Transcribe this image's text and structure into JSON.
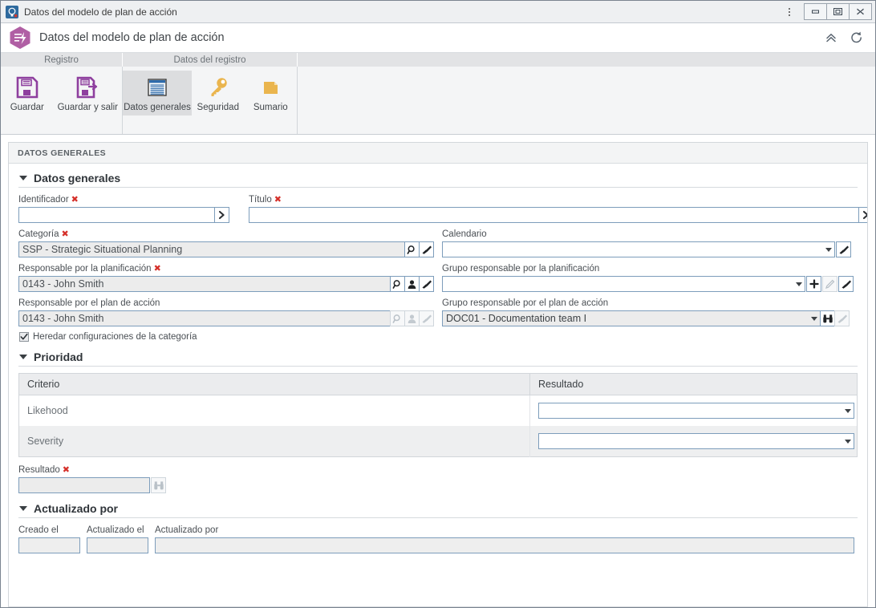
{
  "window": {
    "title": "Datos del modelo de plan de acción",
    "app_icon": "softexpert-hexagon-icon",
    "menu_icon": "vertical-dots-icon",
    "minimize_label": "Minimizar",
    "maximize_label": "Maximizar",
    "close_label": "Cerrar"
  },
  "header": {
    "title": "Datos del modelo de plan de acción",
    "collapse_icon": "double-chevron-up-icon",
    "refresh_icon": "refresh-icon"
  },
  "ribbon": {
    "tabs": [
      {
        "label": "Registro"
      },
      {
        "label": "Datos del registro"
      },
      {
        "label": ""
      }
    ],
    "groups": [
      {
        "buttons": [
          {
            "label": "Guardar",
            "icon": "save-floppy-icon",
            "active": false
          },
          {
            "label": "Guardar y salir",
            "icon": "save-and-exit-floppy-icon",
            "active": false
          }
        ]
      },
      {
        "buttons": [
          {
            "label": "Datos generales",
            "icon": "general-data-window-icon",
            "active": true
          },
          {
            "label": "Seguridad",
            "icon": "key-icon",
            "active": false
          },
          {
            "label": "Sumario",
            "icon": "document-page-icon",
            "active": false
          }
        ]
      }
    ]
  },
  "panel": {
    "header": "DATOS GENERALES"
  },
  "sections": {
    "general": {
      "title": "Datos generales",
      "collapse_icon": "triangle-down-icon",
      "fields": {
        "identificador": {
          "label": "Identificador",
          "required": true,
          "value": "",
          "button_icon": "chevron-right-icon"
        },
        "titulo": {
          "label": "Título",
          "required": true,
          "value": "",
          "button_icon": "chevron-right-icon"
        },
        "categoria": {
          "label": "Categoría",
          "required": true,
          "value": "SSP - Strategic Situational Planning",
          "readonly": true,
          "buttons": [
            "search-magnifier-icon",
            "clear-brush-icon"
          ]
        },
        "calendario": {
          "label": "Calendario",
          "required": false,
          "value": "",
          "buttons": [
            "clear-brush-icon"
          ]
        },
        "responsable_planificacion": {
          "label": "Responsable por la planificación",
          "required": true,
          "value": "0143 - John Smith",
          "readonly": true,
          "buttons": [
            "search-magnifier-icon",
            "person-icon",
            "clear-brush-icon"
          ]
        },
        "grupo_responsable_planificacion": {
          "label": "Grupo responsable por la planificación",
          "required": false,
          "value": "",
          "buttons": [
            "plus-icon",
            "pencil-icon-disabled",
            "clear-brush-icon"
          ]
        },
        "responsable_plan_accion": {
          "label": "Responsable por el plan de acción",
          "required": false,
          "value": "0143 - John Smith",
          "readonly": true,
          "buttons": [
            "search-magnifier-icon-disabled",
            "person-icon-disabled",
            "clear-brush-icon-disabled"
          ]
        },
        "grupo_responsable_plan_accion": {
          "label": "Grupo responsable por el plan de acción",
          "required": false,
          "value": "DOC01 - Documentation team I",
          "readonly": true,
          "buttons": [
            "binoculars-icon",
            "clear-brush-icon-disabled"
          ]
        },
        "heredar": {
          "label": "Heredar configuraciones de la categoría",
          "checked": true,
          "icon": "checkbox-checked-icon"
        }
      }
    },
    "prioridad": {
      "title": "Prioridad",
      "collapse_icon": "triangle-down-icon",
      "table": {
        "columns": [
          "Criterio",
          "Resultado"
        ],
        "rows": [
          {
            "criterio": "Likehood",
            "resultado": "",
            "dropdown_icon": "caret-down-icon"
          },
          {
            "criterio": "Severity",
            "resultado": "",
            "dropdown_icon": "caret-down-icon"
          }
        ]
      },
      "resultado": {
        "label": "Resultado",
        "required": true,
        "value": "",
        "readonly": true,
        "buttons": [
          "binoculars-icon-disabled"
        ]
      }
    },
    "actualizado": {
      "title": "Actualizado por",
      "collapse_icon": "triangle-down-icon",
      "fields": {
        "creado_el": {
          "label": "Creado el",
          "value": ""
        },
        "actualizado_el": {
          "label": "Actualizado el",
          "value": ""
        },
        "actualizado_por": {
          "label": "Actualizado por",
          "value": ""
        }
      }
    }
  },
  "colors": {
    "accent_purple": "#a8519a",
    "icon_gold": "#eab54e",
    "icon_blue": "#3a6fa8",
    "required_red": "#d5302a",
    "field_border": "#7d9dbb"
  }
}
